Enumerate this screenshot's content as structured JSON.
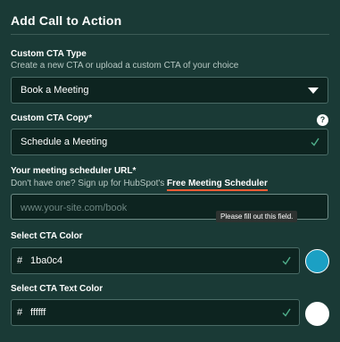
{
  "dialog": {
    "title": "Add Call to Action"
  },
  "cta_type": {
    "label": "Custom CTA Type",
    "description": "Create a new CTA or upload a custom CTA of your choice",
    "selected": "Book a Meeting",
    "icon": "chevron-down-icon"
  },
  "cta_copy": {
    "label": "Custom CTA Copy*",
    "value": "Schedule a Meeting",
    "help_glyph": "?",
    "icon": "check-icon"
  },
  "scheduler_url": {
    "label": "Your meeting scheduler URL*",
    "hint_prefix": "Don't have one? Sign up for HubSpot's ",
    "hint_link": "Free Meeting Scheduler",
    "placeholder": "www.your-site.com/book",
    "validation_tooltip": "Please fill out this field."
  },
  "cta_color": {
    "label": "Select CTA Color",
    "hash": "#",
    "value": "1ba0c4",
    "swatch_color": "#1ba0c4",
    "icon": "check-icon"
  },
  "cta_text_color": {
    "label": "Select CTA Text Color",
    "hash": "#",
    "value": "ffffff",
    "swatch_color": "#ffffff",
    "icon": "check-icon"
  },
  "colors": {
    "background": "#1a3a36",
    "input_background": "#0d2420",
    "accent_underline": "#ff5c35",
    "check": "#4fae8a"
  }
}
